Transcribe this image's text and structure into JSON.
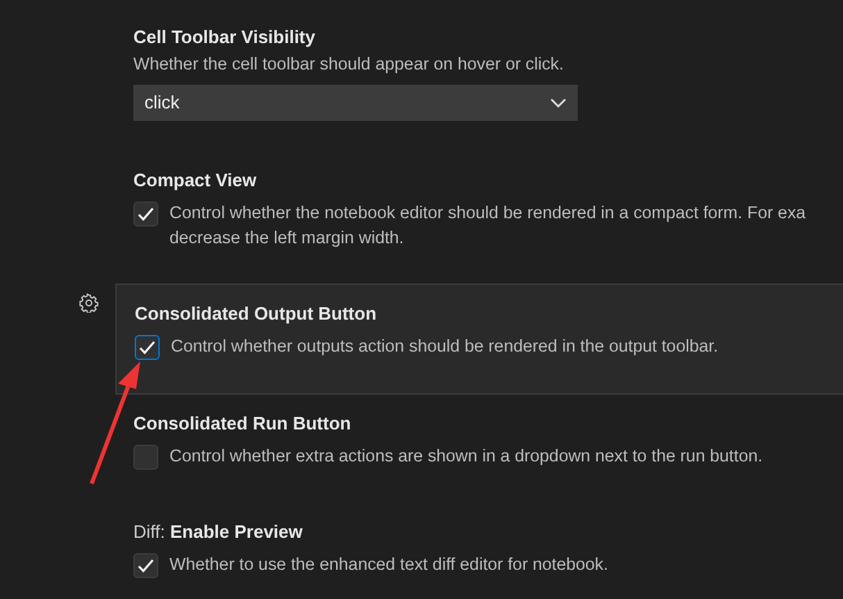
{
  "settings": [
    {
      "kind": "dropdown",
      "title": "Cell Toolbar Visibility",
      "description": [
        "Whether the cell toolbar should appear on hover or click."
      ],
      "value": "click",
      "focused": false
    },
    {
      "kind": "checkbox",
      "title": "Compact View",
      "description": [
        "Control whether the notebook editor should be rendered in a compact form. For exa",
        "decrease the left margin width."
      ],
      "checked": true,
      "focused": false
    },
    {
      "kind": "checkbox",
      "title": "Consolidated Output Button",
      "description": [
        "Control whether outputs action should be rendered in the output toolbar."
      ],
      "checked": true,
      "focused": true
    },
    {
      "kind": "checkbox",
      "title": "Consolidated Run Button",
      "description": [
        "Control whether extra actions are shown in a dropdown next to the run button."
      ],
      "checked": false,
      "focused": false
    },
    {
      "kind": "checkbox",
      "category": "Diff: ",
      "title": "Enable Preview",
      "description": [
        "Whether to use the enhanced text diff editor for notebook."
      ],
      "checked": true,
      "focused": false
    }
  ]
}
